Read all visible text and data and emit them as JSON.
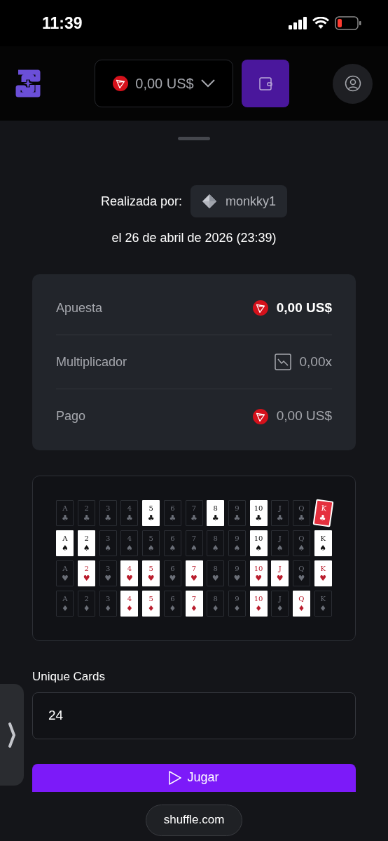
{
  "status_bar": {
    "time": "11:39"
  },
  "header": {
    "balance": "0,00 US$"
  },
  "bet_info": {
    "placed_by_label": "Realizada por:",
    "user": "monkky1",
    "date": "el 26 de abril de 2026 (23:39)"
  },
  "details": [
    {
      "label": "Apuesta",
      "value": "0,00 US$",
      "kind": "coin",
      "emphasis": true
    },
    {
      "label": "Multiplicador",
      "value": "0,00x",
      "kind": "multiplier",
      "emphasis": false
    },
    {
      "label": "Pago",
      "value": "0,00 US$",
      "kind": "coin",
      "emphasis": false
    }
  ],
  "card_rows": [
    {
      "color": "#111111",
      "cards": [
        {
          "rank": "A",
          "suit": "♣",
          "revealed": false,
          "highlighted": false
        },
        {
          "rank": "2",
          "suit": "♣",
          "revealed": false,
          "highlighted": false
        },
        {
          "rank": "3",
          "suit": "♣",
          "revealed": false,
          "highlighted": false
        },
        {
          "rank": "4",
          "suit": "♣",
          "revealed": false,
          "highlighted": false
        },
        {
          "rank": "5",
          "suit": "♣",
          "revealed": true,
          "highlighted": false
        },
        {
          "rank": "6",
          "suit": "♣",
          "revealed": false,
          "highlighted": false
        },
        {
          "rank": "7",
          "suit": "♣",
          "revealed": false,
          "highlighted": false
        },
        {
          "rank": "8",
          "suit": "♣",
          "revealed": true,
          "highlighted": false
        },
        {
          "rank": "9",
          "suit": "♣",
          "revealed": false,
          "highlighted": false
        },
        {
          "rank": "10",
          "suit": "♣",
          "revealed": true,
          "highlighted": false
        },
        {
          "rank": "J",
          "suit": "♣",
          "revealed": false,
          "highlighted": false
        },
        {
          "rank": "Q",
          "suit": "♣",
          "revealed": false,
          "highlighted": false
        },
        {
          "rank": "K",
          "suit": "♣",
          "revealed": true,
          "highlighted": true
        }
      ]
    },
    {
      "color": "#111111",
      "cards": [
        {
          "rank": "A",
          "suit": "♠",
          "revealed": true,
          "highlighted": false
        },
        {
          "rank": "2",
          "suit": "♠",
          "revealed": true,
          "highlighted": false
        },
        {
          "rank": "3",
          "suit": "♠",
          "revealed": false,
          "highlighted": false
        },
        {
          "rank": "4",
          "suit": "♠",
          "revealed": false,
          "highlighted": false
        },
        {
          "rank": "5",
          "suit": "♠",
          "revealed": false,
          "highlighted": false
        },
        {
          "rank": "6",
          "suit": "♠",
          "revealed": false,
          "highlighted": false
        },
        {
          "rank": "7",
          "suit": "♠",
          "revealed": false,
          "highlighted": false
        },
        {
          "rank": "8",
          "suit": "♠",
          "revealed": false,
          "highlighted": false
        },
        {
          "rank": "9",
          "suit": "♠",
          "revealed": false,
          "highlighted": false
        },
        {
          "rank": "10",
          "suit": "♠",
          "revealed": true,
          "highlighted": false
        },
        {
          "rank": "J",
          "suit": "♠",
          "revealed": false,
          "highlighted": false
        },
        {
          "rank": "Q",
          "suit": "♠",
          "revealed": false,
          "highlighted": false
        },
        {
          "rank": "K",
          "suit": "♠",
          "revealed": true,
          "highlighted": false
        }
      ]
    },
    {
      "color": "#b91c2c",
      "cards": [
        {
          "rank": "A",
          "suit": "♥",
          "revealed": false,
          "highlighted": false
        },
        {
          "rank": "2",
          "suit": "♥",
          "revealed": true,
          "highlighted": false
        },
        {
          "rank": "3",
          "suit": "♥",
          "revealed": false,
          "highlighted": false
        },
        {
          "rank": "4",
          "suit": "♥",
          "revealed": true,
          "highlighted": false
        },
        {
          "rank": "5",
          "suit": "♥",
          "revealed": true,
          "highlighted": false
        },
        {
          "rank": "6",
          "suit": "♥",
          "revealed": false,
          "highlighted": false
        },
        {
          "rank": "7",
          "suit": "♥",
          "revealed": true,
          "highlighted": false
        },
        {
          "rank": "8",
          "suit": "♥",
          "revealed": false,
          "highlighted": false
        },
        {
          "rank": "9",
          "suit": "♥",
          "revealed": false,
          "highlighted": false
        },
        {
          "rank": "10",
          "suit": "♥",
          "revealed": true,
          "highlighted": false
        },
        {
          "rank": "J",
          "suit": "♥",
          "revealed": true,
          "highlighted": false
        },
        {
          "rank": "Q",
          "suit": "♥",
          "revealed": false,
          "highlighted": false
        },
        {
          "rank": "K",
          "suit": "♥",
          "revealed": true,
          "highlighted": false
        }
      ]
    },
    {
      "color": "#b91c2c",
      "cards": [
        {
          "rank": "A",
          "suit": "♦",
          "revealed": false,
          "highlighted": false
        },
        {
          "rank": "2",
          "suit": "♦",
          "revealed": false,
          "highlighted": false
        },
        {
          "rank": "3",
          "suit": "♦",
          "revealed": false,
          "highlighted": false
        },
        {
          "rank": "4",
          "suit": "♦",
          "revealed": true,
          "highlighted": false
        },
        {
          "rank": "5",
          "suit": "♦",
          "revealed": true,
          "highlighted": false
        },
        {
          "rank": "6",
          "suit": "♦",
          "revealed": false,
          "highlighted": false
        },
        {
          "rank": "7",
          "suit": "♦",
          "revealed": true,
          "highlighted": false
        },
        {
          "rank": "8",
          "suit": "♦",
          "revealed": false,
          "highlighted": false
        },
        {
          "rank": "9",
          "suit": "♦",
          "revealed": false,
          "highlighted": false
        },
        {
          "rank": "10",
          "suit": "♦",
          "revealed": true,
          "highlighted": false
        },
        {
          "rank": "J",
          "suit": "♦",
          "revealed": false,
          "highlighted": false
        },
        {
          "rank": "Q",
          "suit": "♦",
          "revealed": true,
          "highlighted": false
        },
        {
          "rank": "K",
          "suit": "♦",
          "revealed": false,
          "highlighted": false
        }
      ]
    }
  ],
  "unique_cards": {
    "label": "Unique Cards",
    "value": "24"
  },
  "play_button": {
    "label": "Jugar"
  },
  "url_bar": {
    "url": "shuffle.com"
  }
}
